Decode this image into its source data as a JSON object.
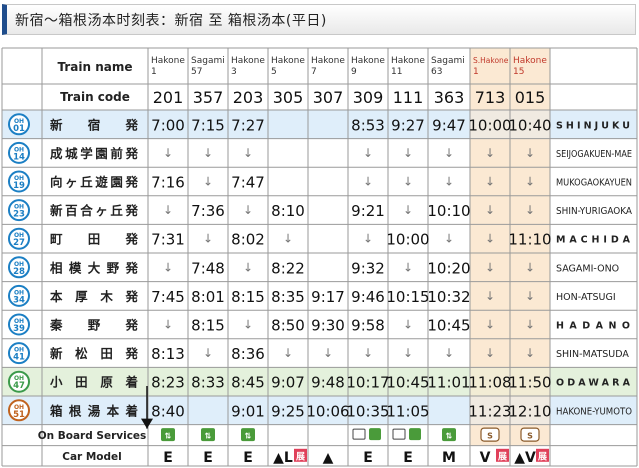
{
  "title": "新宿〜箱根汤本时刻表：新宿 至 箱根汤本(平日)",
  "header": {
    "train_name_label": "Train name",
    "train_code_label": "Train code",
    "services_label": "On Board Services",
    "car_model_label": "Car Model"
  },
  "trains": [
    {
      "name": "Hakone",
      "num": "1",
      "code": "201",
      "romance": false
    },
    {
      "name": "Sagami",
      "num": "57",
      "code": "357",
      "romance": false
    },
    {
      "name": "Hakone",
      "num": "3",
      "code": "203",
      "romance": false
    },
    {
      "name": "Hakone",
      "num": "5",
      "code": "305",
      "romance": false
    },
    {
      "name": "Hakone",
      "num": "7",
      "code": "307",
      "romance": false
    },
    {
      "name": "Hakone",
      "num": "9",
      "code": "309",
      "romance": false
    },
    {
      "name": "Hakone",
      "num": "11",
      "code": "111",
      "romance": false
    },
    {
      "name": "Sagami",
      "num": "63",
      "code": "363",
      "romance": false
    },
    {
      "name": "S.Hakone",
      "num": "1",
      "code": "713",
      "romance": true
    },
    {
      "name": "Hakone",
      "num": "15",
      "code": "015",
      "romance": true
    }
  ],
  "stations": [
    {
      "code": "OH 01",
      "jp": "新宿発",
      "en": "SHINJUKU",
      "times": [
        "7:00",
        "7:15",
        "7:27",
        "",
        "",
        "8:53",
        "9:27",
        "9:47",
        "10:00",
        "10:40"
      ]
    },
    {
      "code": "OH 14",
      "jp": "成城学園前発",
      "en": "SEIJOGAKUEN-MAE",
      "times": [
        "↓",
        "↓",
        "↓",
        "",
        "",
        "↓",
        "↓",
        "↓",
        "↓",
        "↓"
      ]
    },
    {
      "code": "OH 19",
      "jp": "向ヶ丘遊園発",
      "en": "MUKOGAOKAYUEN",
      "times": [
        "7:16",
        "↓",
        "7:47",
        "",
        "",
        "↓",
        "↓",
        "↓",
        "↓",
        "↓"
      ]
    },
    {
      "code": "OH 23",
      "jp": "新百合ヶ丘発",
      "en": "SHIN-YURIGAOKA",
      "times": [
        "↓",
        "7:36",
        "↓",
        "8:10",
        "",
        "9:21",
        "↓",
        "10:10",
        "↓",
        "↓"
      ]
    },
    {
      "code": "OH 27",
      "jp": "町田発",
      "en": "MACHIDA",
      "times": [
        "7:31",
        "↓",
        "8:02",
        "↓",
        "",
        "↓",
        "10:00",
        "↓",
        "↓",
        "11:10"
      ]
    },
    {
      "code": "OH 28",
      "jp": "相模大野発",
      "en": "SAGAMI-ONO",
      "times": [
        "↓",
        "7:48",
        "↓",
        "8:22",
        "",
        "9:32",
        "↓",
        "10:20",
        "↓",
        "↓"
      ]
    },
    {
      "code": "OH 34",
      "jp": "本厚木発",
      "en": "HON-ATSUGI",
      "times": [
        "7:45",
        "8:01",
        "8:15",
        "8:35",
        "9:17",
        "9:46",
        "10:15",
        "10:32",
        "↓",
        "↓"
      ]
    },
    {
      "code": "OH 39",
      "jp": "秦野発",
      "en": "HADANO",
      "times": [
        "↓",
        "8:15",
        "↓",
        "8:50",
        "9:30",
        "9:58",
        "↓",
        "10:45",
        "↓",
        "↓"
      ]
    },
    {
      "code": "OH 41",
      "jp": "新松田発",
      "en": "SHIN-MATSUDA",
      "times": [
        "8:13",
        "↓",
        "8:36",
        "↓",
        "↓",
        "↓",
        "↓",
        "↓",
        "↓",
        "↓"
      ]
    },
    {
      "code": "OH 47",
      "jp": "小田原着",
      "en": "ODAWARA",
      "times": [
        "8:23",
        "8:33",
        "8:45",
        "9:07",
        "9:48",
        "10:17",
        "10:45",
        "11:01",
        "11:08",
        "11:50"
      ]
    },
    {
      "code": "OH 51",
      "jp": "箱根湯本着",
      "en": "HAKONE-YUMOTO",
      "times": [
        "8:40",
        "",
        "9:01",
        "9:25",
        "10:06",
        "10:35",
        "11:05",
        "",
        "11:23",
        "12:10"
      ]
    }
  ],
  "services": [
    "EL",
    "EL",
    "EL",
    "",
    "",
    "CUP",
    "CUP",
    "EL",
    "SEAT",
    "SEAT"
  ],
  "car_models": [
    {
      "label": "E",
      "prefix": "",
      "badge": "",
      "badge_text": ""
    },
    {
      "label": "E",
      "prefix": "",
      "badge": "",
      "badge_text": ""
    },
    {
      "label": "E",
      "prefix": "",
      "badge": "",
      "badge_text": ""
    },
    {
      "label": "L",
      "prefix": "▲",
      "badge": "#e0405a",
      "badge_text": "展"
    },
    {
      "label": "",
      "prefix": "▲",
      "badge": "",
      "badge_text": ""
    },
    {
      "label": "E",
      "prefix": "",
      "badge": "",
      "badge_text": ""
    },
    {
      "label": "E",
      "prefix": "",
      "badge": "",
      "badge_text": ""
    },
    {
      "label": "M",
      "prefix": "",
      "badge": "",
      "badge_text": ""
    },
    {
      "label": "V",
      "prefix": "",
      "badge": "#e0405a",
      "badge_text": "展"
    },
    {
      "label": "V",
      "prefix": "▲",
      "badge": "#e0405a",
      "badge_text": "展"
    }
  ],
  "colors": {
    "blue_row": "#dcecf9",
    "green_row": "#e1f0d8",
    "romance_col": "#fbe9d3",
    "circle_blue": "#1b7fc4",
    "circle_green": "#3b9a4a",
    "circle_orange": "#c0621e",
    "service_green": "#4a9b3a"
  }
}
